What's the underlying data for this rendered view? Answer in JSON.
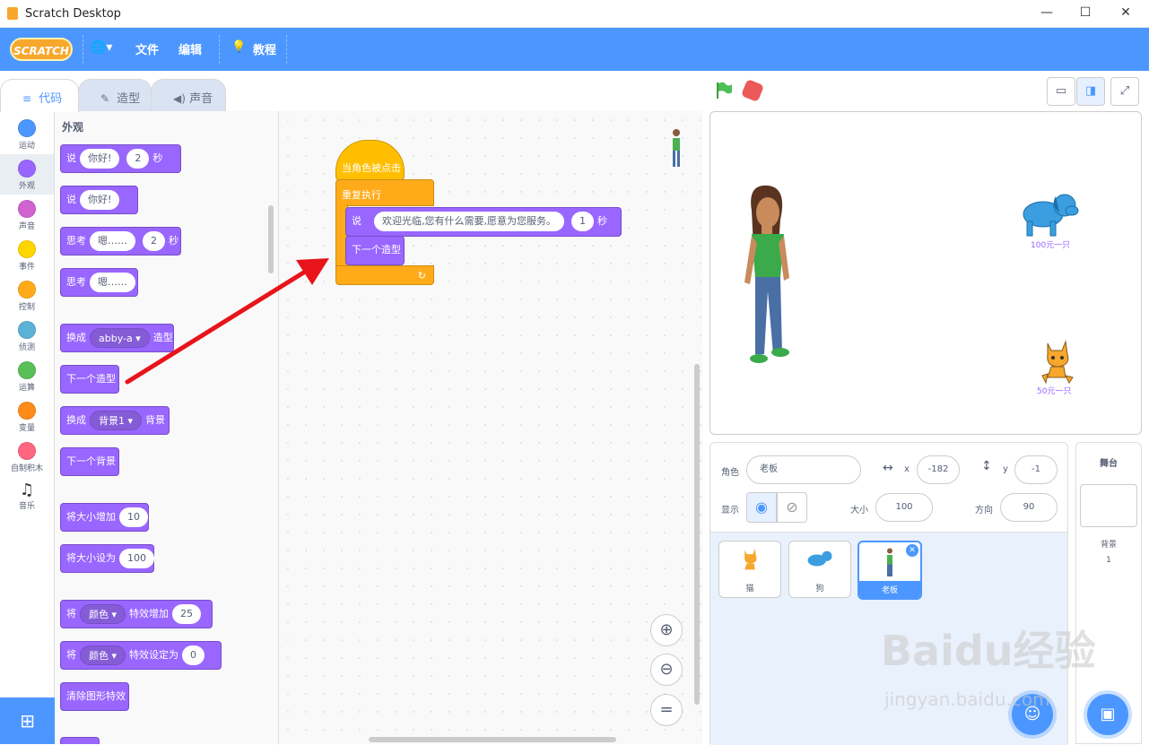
{
  "window": {
    "title": "Scratch Desktop",
    "minimize": "—",
    "maximize": "☐",
    "close": "✕"
  },
  "menubar": {
    "logo": "SCRATCH",
    "language_icon": "🌐▾",
    "file": "文件",
    "edit": "编辑",
    "tutorials": "教程"
  },
  "tabs": {
    "code": "代码",
    "costumes": "造型",
    "sounds": "声音"
  },
  "categories": [
    {
      "label": "运动",
      "color": "#4c97ff"
    },
    {
      "label": "外观",
      "color": "#9966ff"
    },
    {
      "label": "声音",
      "color": "#cf63cf"
    },
    {
      "label": "事件",
      "color": "#ffd500"
    },
    {
      "label": "控制",
      "color": "#ffab19"
    },
    {
      "label": "侦测",
      "color": "#5cb1d6"
    },
    {
      "label": "运算",
      "color": "#59c059"
    },
    {
      "label": "变量",
      "color": "#ff8c1a"
    },
    {
      "label": "自制积木",
      "color": "#ff6680"
    },
    {
      "label": "音乐",
      "color": "#ffffff"
    }
  ],
  "palette": {
    "title": "外观",
    "say_for": {
      "say": "说",
      "text": "你好!",
      "secs": "2",
      "unit": "秒"
    },
    "say": {
      "say": "说",
      "text": "你好!"
    },
    "think_for": {
      "think": "思考",
      "text": "嗯……",
      "secs": "2",
      "unit": "秒"
    },
    "think": {
      "think": "思考",
      "text": "嗯……"
    },
    "switch_costume": {
      "a": "换成",
      "dd": "abby-a ▾",
      "b": "造型"
    },
    "next_costume": "下一个造型",
    "switch_backdrop": {
      "a": "换成",
      "dd": "背景1 ▾",
      "b": "背景"
    },
    "next_backdrop": "下一个背景",
    "change_size": {
      "a": "将大小增加",
      "v": "10"
    },
    "set_size": {
      "a": "将大小设为",
      "v": "100"
    },
    "change_effect": {
      "a": "将",
      "dd": "颜色 ▾",
      "b": "特效增加",
      "v": "25"
    },
    "set_effect": {
      "a": "将",
      "dd": "颜色 ▾",
      "b": "特效设定为",
      "v": "0"
    },
    "clear_effects": "清除图形特效"
  },
  "script": {
    "hat": "当角色被点击",
    "forever": "重复执行",
    "say_label": "说",
    "say_text": "欢迎光临,您有什么需要,愿意为您服务。",
    "say_secs": "1",
    "say_unit": "秒",
    "next_costume": "下一个造型",
    "loop_arrow": "↻"
  },
  "zoom": {
    "in": "⊕",
    "out": "⊖",
    "reset": "="
  },
  "stage": {
    "dog_price": "100元一只",
    "cat_price": "50元一只"
  },
  "sprite_info": {
    "sprite_label": "角色",
    "sprite_name": "老板",
    "x_label": "x",
    "x": "-182",
    "y_label": "y",
    "y": "-1",
    "show_label": "显示",
    "size_label": "大小",
    "size": "100",
    "direction_label": "方向",
    "direction": "90"
  },
  "sprites": [
    {
      "name": "猫"
    },
    {
      "name": "狗"
    },
    {
      "name": "老板"
    }
  ],
  "stage_panel": {
    "title": "舞台",
    "backdrops_label": "背景",
    "backdrops_count": "1"
  },
  "watermark": {
    "main": "Baidu经验",
    "sub": "jingyan.baidu.com"
  }
}
